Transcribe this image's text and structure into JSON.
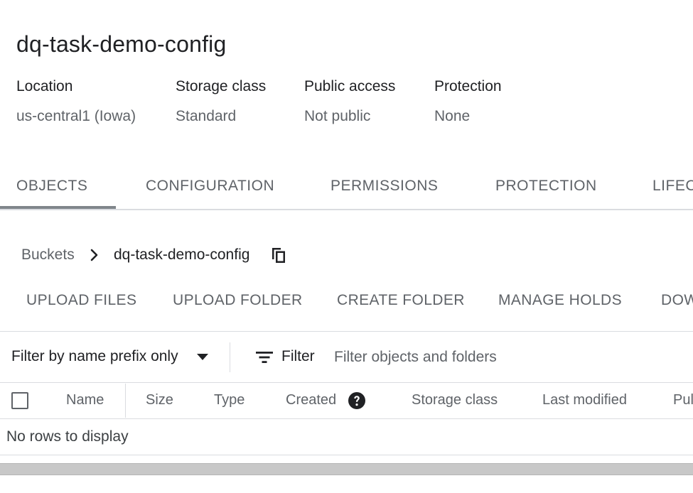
{
  "bucket": {
    "name": "dq-task-demo-config",
    "details": [
      {
        "label": "Location",
        "value": "us-central1 (Iowa)"
      },
      {
        "label": "Storage class",
        "value": "Standard"
      },
      {
        "label": "Public access",
        "value": "Not public"
      },
      {
        "label": "Protection",
        "value": "None"
      }
    ]
  },
  "tabs": [
    {
      "label": "OBJECTS",
      "active": true
    },
    {
      "label": "CONFIGURATION",
      "active": false
    },
    {
      "label": "PERMISSIONS",
      "active": false
    },
    {
      "label": "PROTECTION",
      "active": false
    },
    {
      "label": "LIFEC",
      "active": false
    }
  ],
  "breadcrumb": {
    "root": "Buckets",
    "current": "dq-task-demo-config",
    "separator_icon": "chevron-right-icon",
    "copy_icon": "copy-icon"
  },
  "actions": [
    "UPLOAD FILES",
    "UPLOAD FOLDER",
    "CREATE FOLDER",
    "MANAGE HOLDS",
    "DOW"
  ],
  "filter": {
    "mode": "Filter by name prefix only",
    "label": "Filter",
    "placeholder": "Filter objects and folders",
    "value": ""
  },
  "table": {
    "columns": [
      "Name",
      "Size",
      "Type",
      "Created",
      "Storage class",
      "Last modified",
      "Pul"
    ],
    "empty_message": "No rows to display"
  },
  "colors": {
    "text_primary": "#202124",
    "text_secondary": "#5f6368",
    "divider": "#dadce0",
    "tab_indicator": "#80868b"
  }
}
